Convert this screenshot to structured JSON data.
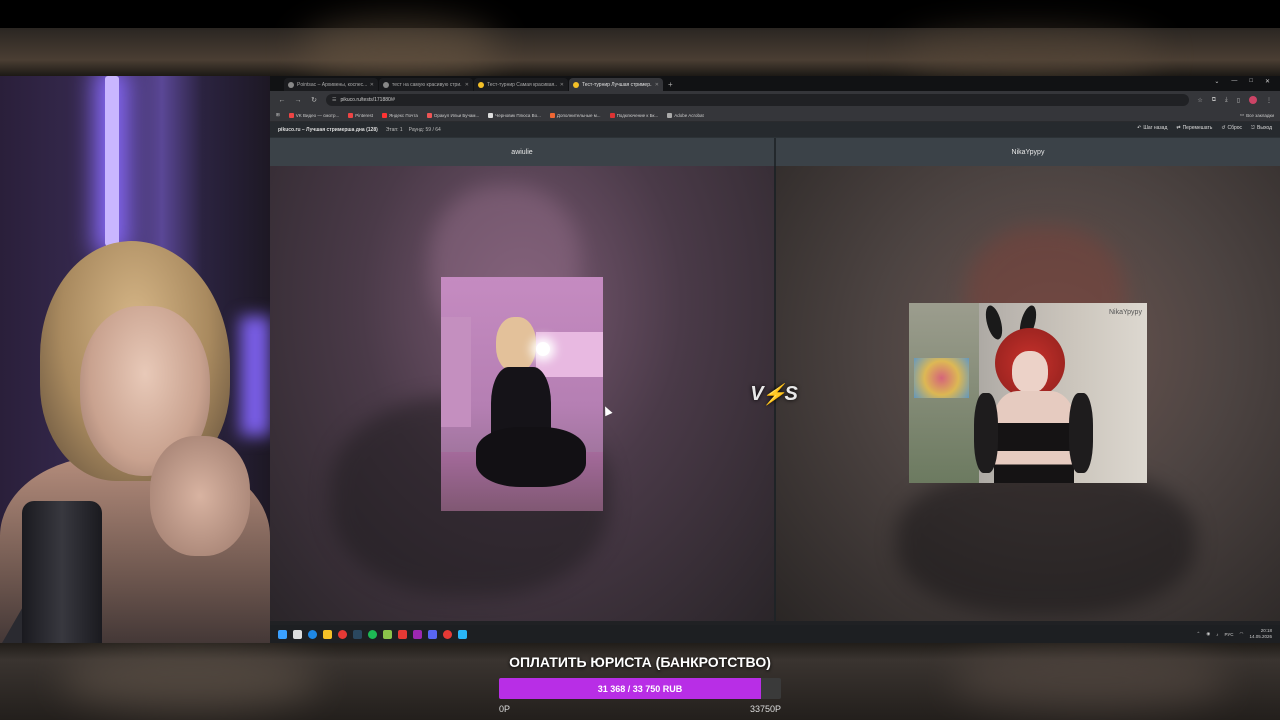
{
  "browser": {
    "tabs": [
      {
        "label": "Pointsac – Архивены, коспес...",
        "active": false
      },
      {
        "label": "тест на самую красивую стри...",
        "active": false
      },
      {
        "label": "Тест-турнир Самая красивая...",
        "active": false
      },
      {
        "label": "Тест-турнир Лучшая стример...",
        "active": true
      }
    ],
    "url": "pikuco.ru/tests/171880/#",
    "bookmarks": [
      "VK Видео — смотр...",
      "Pinterest",
      "Яндекс Почта",
      "Оракул Ильи Бучам...",
      "Черновик Плюса Во...",
      "Дополнительные м...",
      "Подключение к Бк...",
      "Adobe Acrobat"
    ],
    "bookmarks_all": "Все закладки"
  },
  "site": {
    "title": "pikuco.ru – Лучшая стримерша дна (128)",
    "stage": "Этап: 1",
    "round": "Раунд: 59 / 64",
    "actions": {
      "back": "Шаг назад",
      "shuffle": "Перемешать",
      "reset": "Сброс",
      "exit": "Выход"
    }
  },
  "contest": {
    "left_name": "awiulie",
    "right_name": "NikaYpypy",
    "vs_text": "VS"
  },
  "taskbar": {
    "lang": "РУС",
    "time": "20:18",
    "date": "14.05.2026"
  },
  "donation_goal": {
    "title": "ОПЛАТИТЬ ЮРИСТА (БАНКРОТСТВО)",
    "progress_text": "31 368 / 33 750 RUB",
    "progress_fraction": 0.929,
    "min_label": "0Р",
    "max_label": "33750Р",
    "fill_color": "#b82ee6"
  }
}
